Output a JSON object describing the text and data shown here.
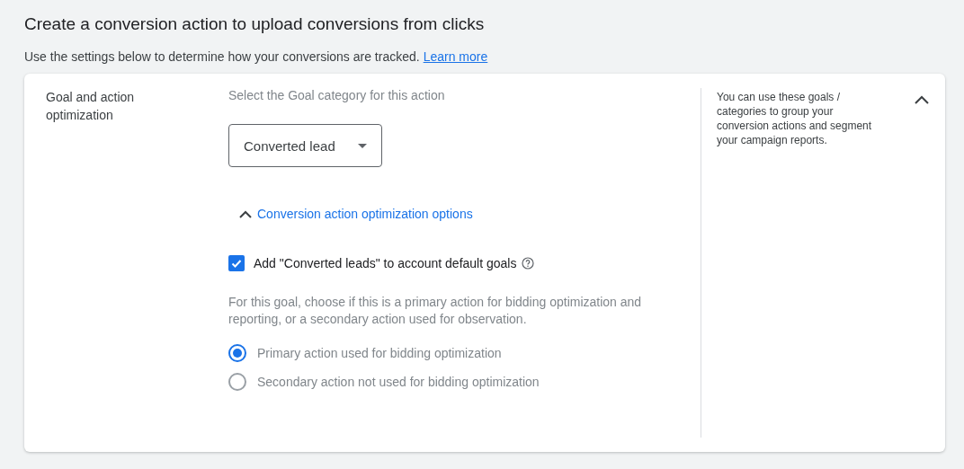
{
  "header": {
    "title": "Create a conversion action to upload conversions from clicks",
    "description": "Use the settings below to determine how your conversions are tracked.",
    "learn_more": "Learn more"
  },
  "section": {
    "label": "Goal and action optimization",
    "expanded": true,
    "category_prompt": "Select the Goal category for this action",
    "category_dropdown": {
      "value": "Converted lead"
    },
    "optimization_toggle": {
      "label": "Conversion action optimization options",
      "expanded": true
    },
    "default_goal_checkbox": {
      "label": "Add \"Converted leads\" to account default goals",
      "checked": true
    },
    "action_description": "For this goal, choose if this is a primary action for bidding optimization and reporting, or a secondary action used for observation.",
    "action_options": [
      {
        "label": "Primary action used for bidding optimization",
        "selected": true
      },
      {
        "label": "Secondary action not used for bidding optimization",
        "selected": false
      }
    ],
    "help_text": "You can use these goals / categories to group your conversion actions and segment your campaign reports."
  }
}
